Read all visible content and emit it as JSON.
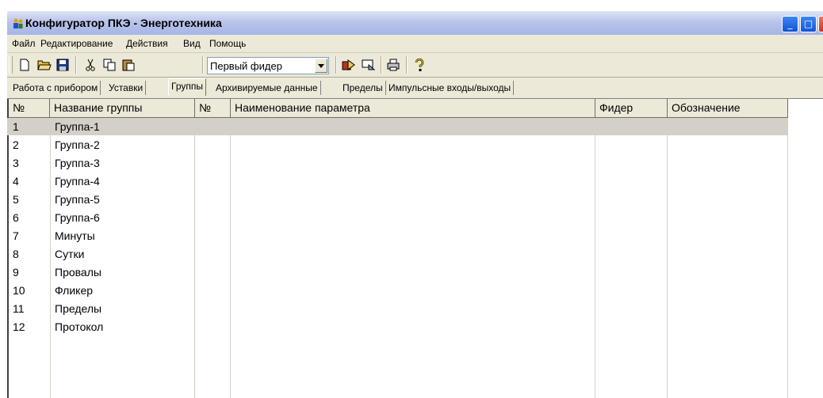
{
  "window": {
    "title": "Конфигуратор ПКЭ - Энерготехника",
    "controls": {
      "minimize": "_",
      "maximize": "□",
      "close": "X"
    }
  },
  "menu": [
    "Файл",
    "Редактирование",
    "Действия",
    "Вид",
    "Помощь"
  ],
  "toolbar": {
    "icons": [
      "new-file-icon",
      "open-folder-icon",
      "save-icon",
      "cut-icon",
      "copy-icon",
      "paste-icon",
      "read-device-icon",
      "write-device-icon",
      "print-icon",
      "help-icon"
    ],
    "feeder_select": "Первый фидер"
  },
  "tabs": [
    "Работа с прибором",
    "Уставки",
    "Группы",
    "Архивируемые данные",
    "Пределы",
    "Импульсные входы/выходы"
  ],
  "active_tab": "Группы",
  "table": {
    "columns": [
      "№",
      "Название группы",
      "№",
      "Наименование параметра",
      "Фидер",
      "Обозначение"
    ],
    "rows": [
      {
        "num": "1",
        "name": "Группа-1"
      },
      {
        "num": "2",
        "name": "Группа-2"
      },
      {
        "num": "3",
        "name": "Группа-3"
      },
      {
        "num": "4",
        "name": "Группа-4"
      },
      {
        "num": "5",
        "name": "Группа-5"
      },
      {
        "num": "6",
        "name": "Группа-6"
      },
      {
        "num": "7",
        "name": "Минуты"
      },
      {
        "num": "8",
        "name": "Сутки"
      },
      {
        "num": "9",
        "name": "Провалы"
      },
      {
        "num": "10",
        "name": "Фликер"
      },
      {
        "num": "11",
        "name": "Пределы"
      },
      {
        "num": "12",
        "name": "Протокол"
      }
    ],
    "selected_row": 1
  },
  "colors": {
    "title_gradient_top": "#dde3f6",
    "title_gradient_bottom": "#a6b5e6",
    "selection": "#d4d0c8",
    "close_button": "#c2381f"
  }
}
